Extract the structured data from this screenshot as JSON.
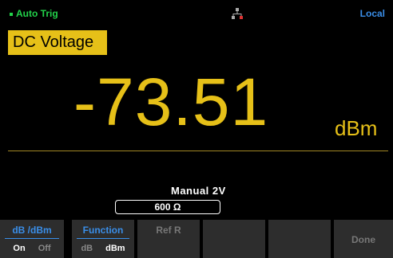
{
  "status": {
    "trigger_mode": "Auto Trig",
    "remote_state": "Local",
    "network_icon": "lan-network-icon"
  },
  "measurement": {
    "function": "DC Voltage",
    "value": "-73.51",
    "unit": "dBm"
  },
  "range": {
    "label": "Manual  2V"
  },
  "reference_resistance": {
    "value": "600",
    "unit": "Ω"
  },
  "softkeys": [
    {
      "title": "dB /dBm",
      "options": [
        "On",
        "Off"
      ],
      "selected": "On"
    },
    {
      "title": "Function",
      "options": [
        "dB",
        "dBm"
      ],
      "selected": "dBm"
    },
    {
      "title": "Ref R"
    },
    {
      "title": ""
    },
    {
      "title": ""
    },
    {
      "title": "Done"
    }
  ],
  "colors": {
    "accent_yellow": "#e6c018",
    "status_green": "#22d24a",
    "label_blue": "#3a8ee8",
    "softkey_bg": "#2d2d2d"
  }
}
